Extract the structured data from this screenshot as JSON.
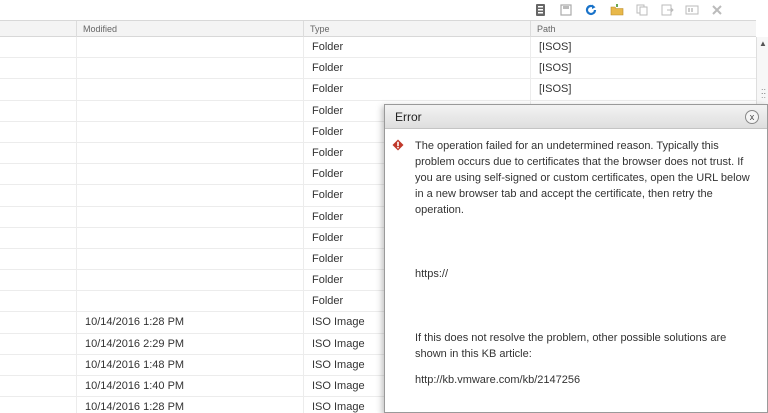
{
  "toolbar": {
    "icons": [
      "database-icon",
      "save-icon",
      "refresh-icon",
      "folder-icon",
      "copy-icon",
      "export-icon",
      "rename-icon",
      "delete-icon"
    ]
  },
  "columns": {
    "col0": "",
    "modified": "Modified",
    "type": "Type",
    "path": "Path"
  },
  "rows": [
    {
      "modified": "",
      "type": "Folder",
      "path": "[ISOS]"
    },
    {
      "modified": "",
      "type": "Folder",
      "path": "[ISOS]"
    },
    {
      "modified": "",
      "type": "Folder",
      "path": "[ISOS]"
    },
    {
      "modified": "",
      "type": "Folder",
      "path": ""
    },
    {
      "modified": "",
      "type": "Folder",
      "path": ""
    },
    {
      "modified": "",
      "type": "Folder",
      "path": ""
    },
    {
      "modified": "",
      "type": "Folder",
      "path": ""
    },
    {
      "modified": "",
      "type": "Folder",
      "path": ""
    },
    {
      "modified": "",
      "type": "Folder",
      "path": ""
    },
    {
      "modified": "",
      "type": "Folder",
      "path": ""
    },
    {
      "modified": "",
      "type": "Folder",
      "path": ""
    },
    {
      "modified": "",
      "type": "Folder",
      "path": ""
    },
    {
      "modified": "",
      "type": "Folder",
      "path": ""
    },
    {
      "modified": "10/14/2016 1:28 PM",
      "type": "ISO Image",
      "path": ""
    },
    {
      "modified": "10/14/2016 2:29 PM",
      "type": "ISO Image",
      "path": ""
    },
    {
      "modified": "10/14/2016 1:48 PM",
      "type": "ISO Image",
      "path": ""
    },
    {
      "modified": "10/14/2016 1:40 PM",
      "type": "ISO Image",
      "path": ""
    },
    {
      "modified": "10/14/2016 1:28 PM",
      "type": "ISO Image",
      "path": ""
    }
  ],
  "dialog": {
    "title": "Error",
    "close_glyph": "x",
    "message": "The operation failed for an undetermined reason. Typically this problem occurs due to certificates that the browser does not trust. If you are using self-signed or custom certificates, open the URL below in a new browser tab and accept the certificate, then retry the operation.",
    "url": "https://",
    "kb_text": "If this does not resolve the problem, other possible solutions are shown in this KB article:",
    "kb_link": "http://kb.vmware.com/kb/2147256"
  },
  "colors": {
    "error_red": "#c0392b",
    "refresh_blue": "#1a73c9",
    "folder_yellow": "#e8b84a"
  }
}
